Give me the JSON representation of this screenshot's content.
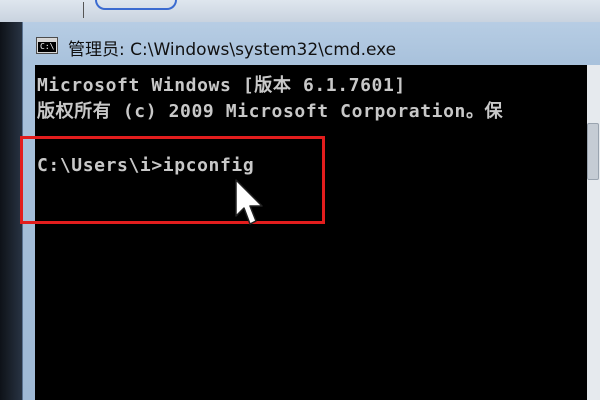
{
  "window": {
    "title": "管理员: C:\\Windows\\system32\\cmd.exe",
    "icon": "cmd-icon"
  },
  "console": {
    "lines": [
      "Microsoft Windows [版本 6.1.7601]",
      "版权所有 (c) 2009 Microsoft Corporation。保",
      "C:\\Users\\i>ipconfig"
    ],
    "text_color": "#c8c8c8",
    "background_color": "#000000"
  },
  "annotation": {
    "highlight_color": "#e21d1d"
  },
  "cursor": {
    "icon": "mouse-pointer-icon"
  }
}
